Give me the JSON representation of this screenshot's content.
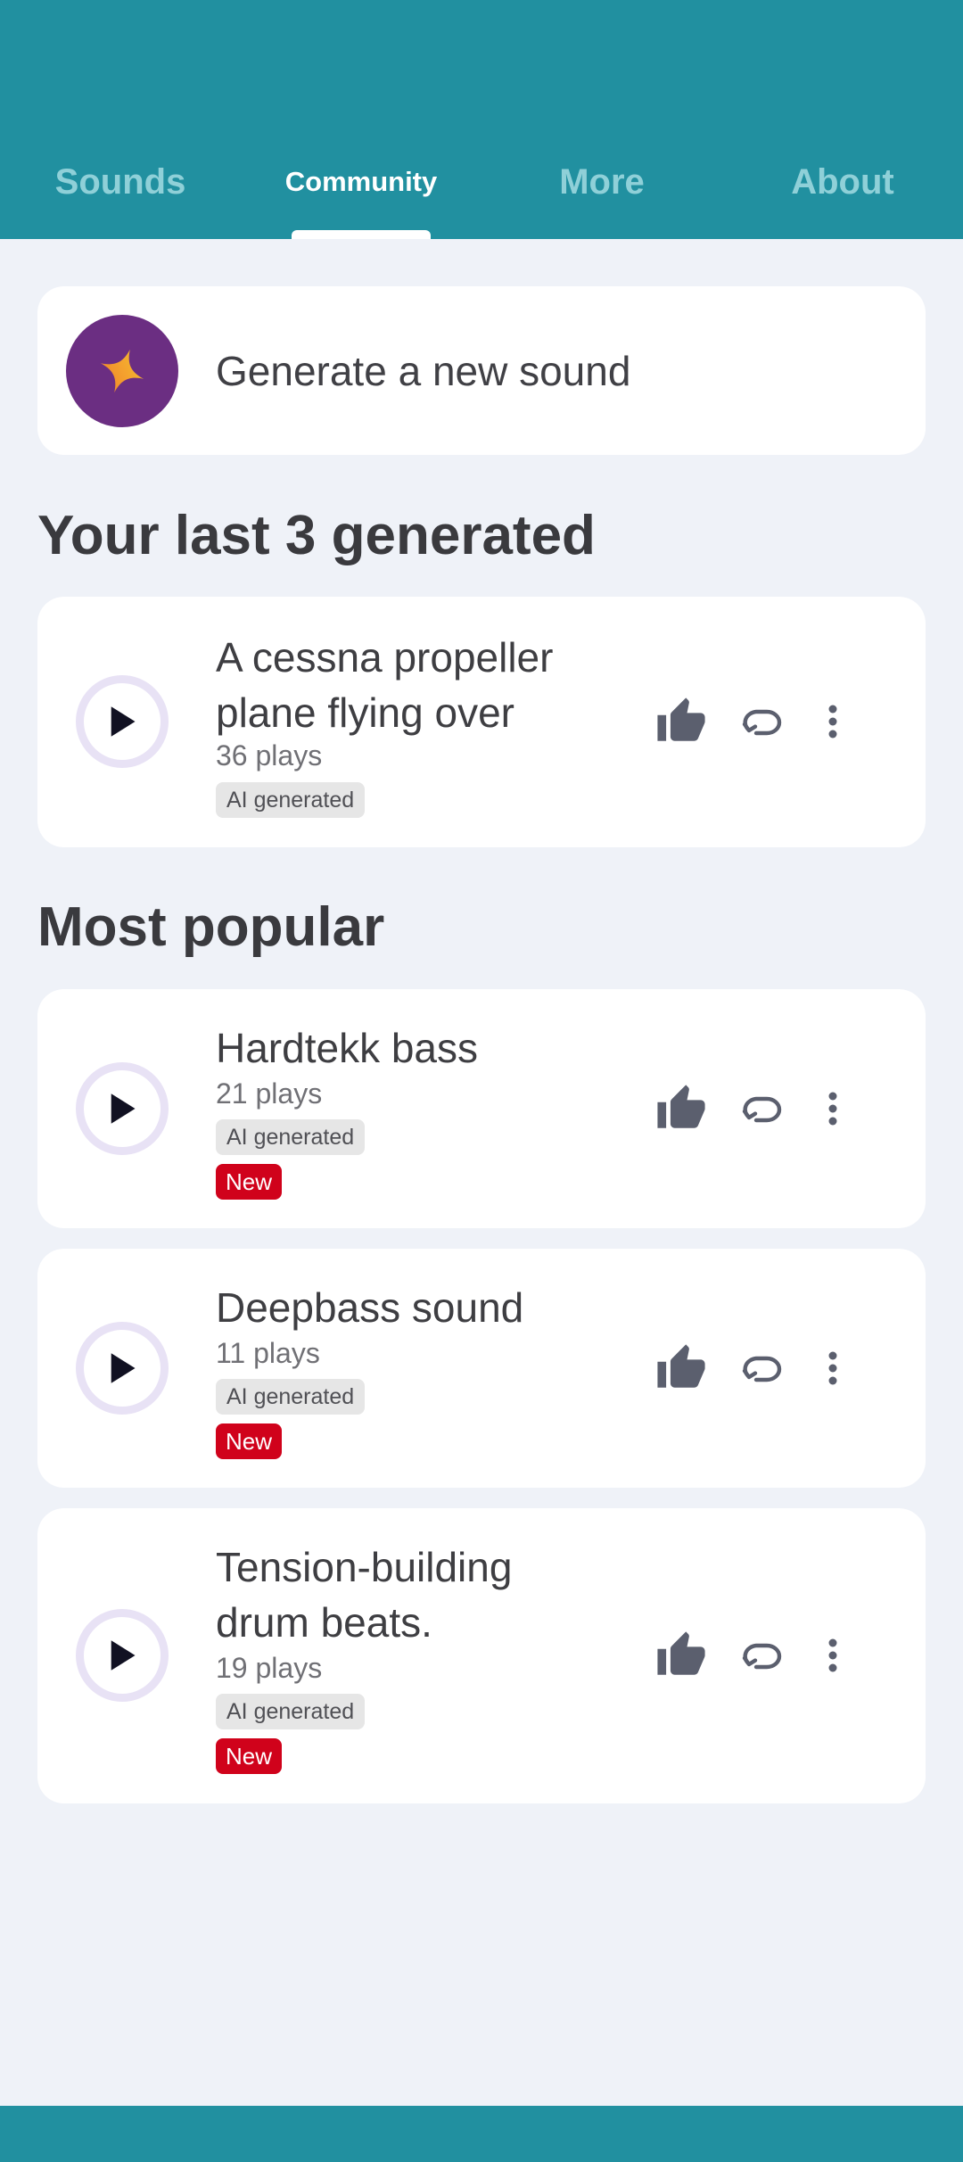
{
  "tabs": [
    {
      "label": "Sounds"
    },
    {
      "label": "Community"
    },
    {
      "label": "More"
    },
    {
      "label": "About"
    }
  ],
  "generate": {
    "label": "Generate a new sound",
    "icon": "sparkle-icon"
  },
  "last_generated": {
    "title": "Your last 3 generated",
    "items": [
      {
        "title": "A cessna propeller plane flying over",
        "plays": "36 plays",
        "badge": "AI generated"
      }
    ]
  },
  "popular": {
    "title": "Most popular",
    "items": [
      {
        "title": "Hardtekk bass",
        "plays": "21 plays",
        "badge": "AI generated",
        "new": "New"
      },
      {
        "title": "Deepbass sound",
        "plays": "11 plays",
        "badge": "AI generated",
        "new": "New"
      },
      {
        "title": "Tension-building drum beats.",
        "plays": "19 plays",
        "badge": "AI generated",
        "new": "New"
      }
    ]
  },
  "colors": {
    "primary": "#2190a0",
    "accent": "#6b2e82",
    "new_badge": "#d0021b"
  }
}
